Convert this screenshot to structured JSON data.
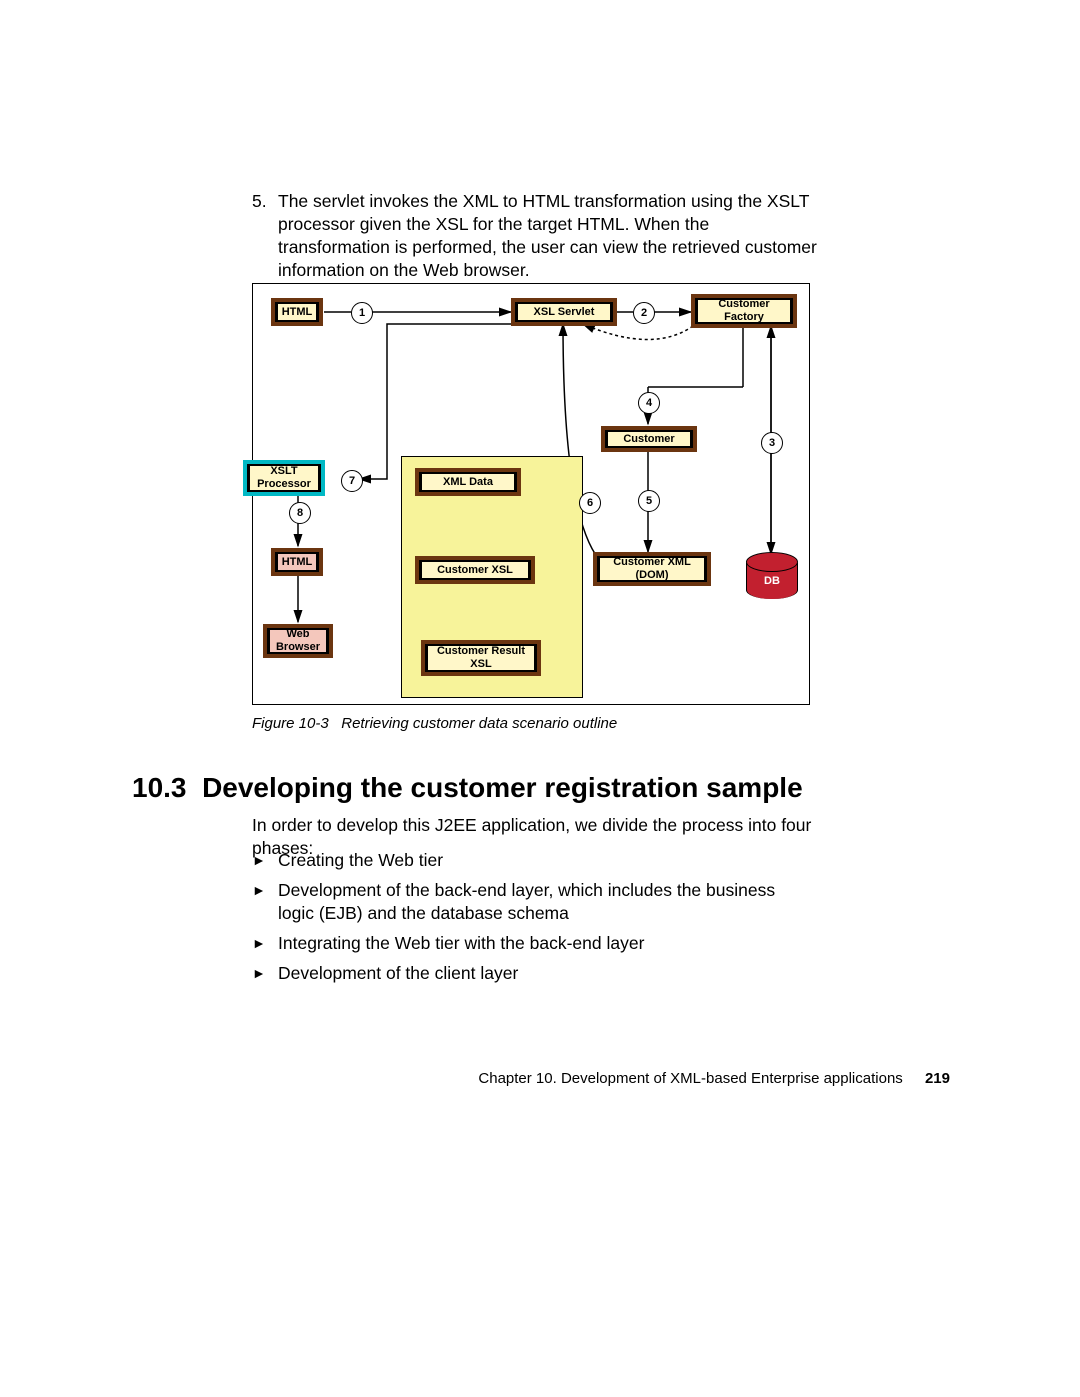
{
  "paragraph": {
    "number": "5.",
    "text": "The servlet invokes the XML to HTML transformation using the XSLT processor given the XSL for the target HTML. When the transformation is performed, the user can view the retrieved customer information on the Web browser."
  },
  "figure": {
    "caption_label": "Figure 10-3",
    "caption_text": "Retrieving customer data scenario outline",
    "boxes": {
      "html_top": "HTML",
      "xsl_servlet": "XSL Servlet",
      "customer_factory": "Customer Factory",
      "customer": "Customer",
      "xslt_processor": "XSLT Processor",
      "xml_data": "XML Data",
      "customer_xml_dom": "Customer XML (DOM)",
      "customer_xsl": "Customer XSL",
      "html_left": "HTML",
      "web_browser": "Web Browser",
      "customer_result_xsl": "Customer Result XSL",
      "db": "DB"
    },
    "badges": [
      "1",
      "2",
      "3",
      "4",
      "5",
      "6",
      "7",
      "8"
    ]
  },
  "section": {
    "number": "10.3",
    "title": "Developing the customer registration sample",
    "intro": "In order to develop this J2EE application, we divide the process into four phases:",
    "bullets": [
      "Creating the Web tier",
      "Development of the back-end layer, which includes the business logic (EJB) and the database schema",
      "Integrating the Web tier with the back-end layer",
      "Development of the client layer"
    ]
  },
  "footer": {
    "chapter": "Chapter 10. Development of XML-based Enterprise applications",
    "page": "219"
  }
}
